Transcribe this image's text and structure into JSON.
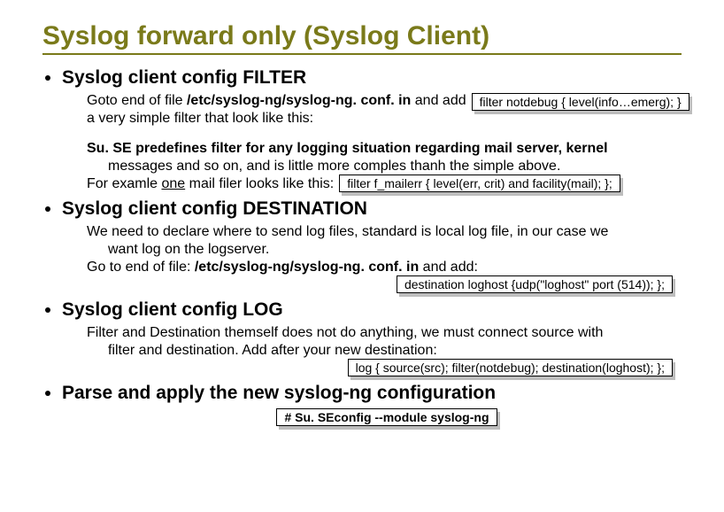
{
  "title": "Syslog forward only (Syslog Client)",
  "sections": {
    "filter": {
      "heading": "Syslog client config FILTER",
      "line1_a": "Goto end of file ",
      "line1_b": "/etc/syslog-ng/syslog-ng. conf. in",
      "line1_c": " and add",
      "line2": "a very simple filter that look like this:",
      "codebox1": "filter  notdebug { level(info…emerg); }",
      "para2_l1": "Su. SE predefines filter for any logging situation regarding mail server, kernel",
      "para2_l2": "messages and so on, and is little more comples thanh the simple above.",
      "para2_l3a": "For examle ",
      "para2_l3u": "one",
      "para2_l3b": " mail filer looks like this:",
      "codebox2": "filter f_mailerr     { level(err, crit) and facility(mail); };"
    },
    "dest": {
      "heading": "Syslog client config DESTINATION",
      "l1": "We need to declare where to send log files, standard is local log file, in our case we",
      "l2": "want log on the logserver.",
      "l3a": "Go to end of file: ",
      "l3b": "/etc/syslog-ng/syslog-ng. conf. in",
      "l3c": " and add:",
      "codebox": "destination loghost {udp(\"loghost\" port (514)); };"
    },
    "log": {
      "heading": "Syslog client config LOG",
      "l1": "Filter and Destination themself does not do anything, we must connect source with",
      "l2": "filter and destination. Add after your new destination:",
      "codebox": "log {  source(src); filter(notdebug); destination(loghost);  };"
    },
    "parse": {
      "heading": "Parse and apply the new syslog-ng configuration",
      "codebox": "# Su. SEconfig --module syslog-ng"
    }
  }
}
